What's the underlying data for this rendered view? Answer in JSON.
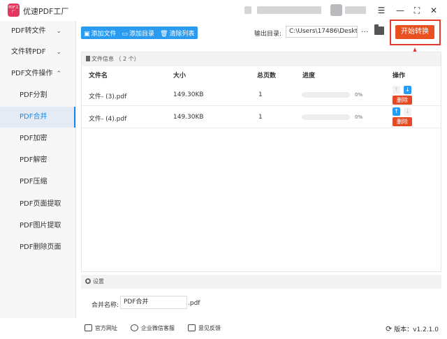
{
  "app": {
    "title": "优速PDF工厂",
    "logo_text": "PDF工厂"
  },
  "sidebar": {
    "items": [
      {
        "label": "PDF转文件",
        "chevron": "⌄"
      },
      {
        "label": "文件转PDF",
        "chevron": "⌄"
      },
      {
        "label": "PDF文件操作",
        "chevron": "⌃"
      },
      {
        "label": "PDF分割"
      },
      {
        "label": "PDF合并"
      },
      {
        "label": "PDF加密"
      },
      {
        "label": "PDF解密"
      },
      {
        "label": "PDF压缩"
      },
      {
        "label": "PDF页面提取"
      },
      {
        "label": "PDF图片提取"
      },
      {
        "label": "PDF删除页面"
      }
    ]
  },
  "toolbar": {
    "add_file": "添加文件",
    "add_dir": "添加目录",
    "clear_list": "清除列表",
    "output_label": "输出目录:",
    "output_path": "C:\\Users\\17486\\Deskto",
    "more": "···",
    "start": "开始转换"
  },
  "file_info": {
    "header": "文件信息 （ 2 个）",
    "columns": {
      "name": "文件名",
      "size": "大小",
      "pages": "总页数",
      "progress": "进度",
      "ops": "操作"
    },
    "rows": [
      {
        "name": "文件- (3).pdf",
        "size": "149.30KB",
        "pages": "1",
        "progress": "0%",
        "delete": "删除"
      },
      {
        "name": "文件- (4).pdf",
        "size": "149.30KB",
        "pages": "1",
        "progress": "0%",
        "delete": "删除"
      }
    ]
  },
  "settings": {
    "header": "设置",
    "merge_label": "合并名称:",
    "merge_value": "PDF合并",
    "merge_ext": ".pdf"
  },
  "footer": {
    "website": "官方网址",
    "wechat": "企业微信客服",
    "feedback": "意见反馈",
    "version": "版本：v1.2.1.0"
  },
  "colors": {
    "accent": "#2b9bf0",
    "start": "#e8501f",
    "highlight": "#e63a2e",
    "delete": "#e34a24"
  }
}
